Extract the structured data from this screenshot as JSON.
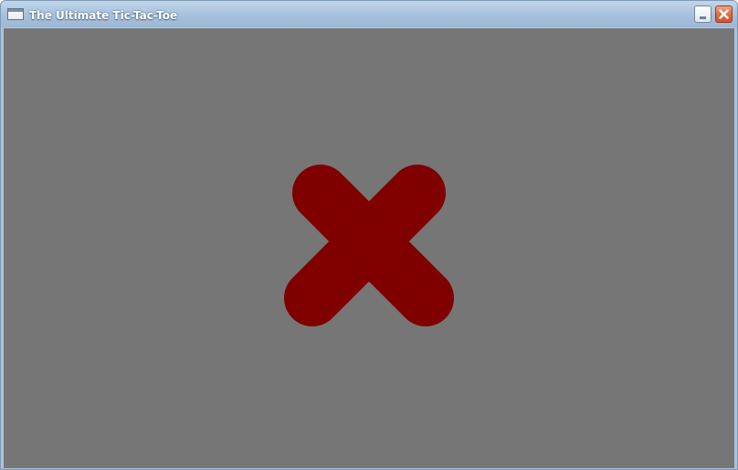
{
  "window": {
    "title": "The Ultimate Tic-Tac-Toe"
  },
  "titlebar_buttons": {
    "minimize_icon": "minimize-icon",
    "close_icon": "close-icon"
  },
  "game": {
    "background_color": "#767676",
    "mark": "X",
    "mark_color": "#800000"
  }
}
